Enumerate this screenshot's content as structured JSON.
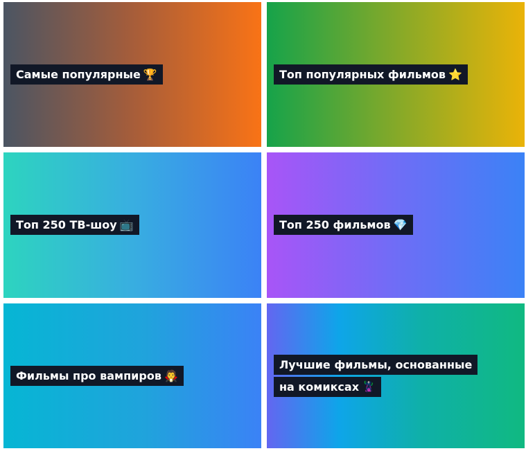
{
  "cards": [
    {
      "title": "Самые популярные",
      "icon": "trophy-icon",
      "glyph": "🏆"
    },
    {
      "title": "Топ популярных фильмов",
      "icon": "star-icon",
      "glyph": "⭐"
    },
    {
      "title": "Топ 250 ТВ-шоу",
      "icon": "tv-icon",
      "glyph": "📺"
    },
    {
      "title": "Топ 250 фильмов",
      "icon": "gem-icon",
      "glyph": "💎"
    },
    {
      "title": "Фильмы про вампиров",
      "icon": "vampire-icon",
      "glyph": "🧛"
    },
    {
      "title": "Лучшие фильмы, основанные на комиксах",
      "icon": "superhero-icon",
      "glyph": "🦹"
    }
  ],
  "colors": {
    "label_bg": "#111827",
    "label_text": "#ffffff",
    "card1": [
      "#4b5563",
      "#f97316"
    ],
    "card2": [
      "#16a34a",
      "#eab308"
    ],
    "card3": [
      "#2dd4bf",
      "#3b82f6"
    ],
    "card4": [
      "#a855f7",
      "#3b82f6"
    ],
    "card5": [
      "#06b6d4",
      "#3b82f6"
    ],
    "card6": [
      "#6366f1",
      "#0ea5e9",
      "#10b981"
    ]
  }
}
